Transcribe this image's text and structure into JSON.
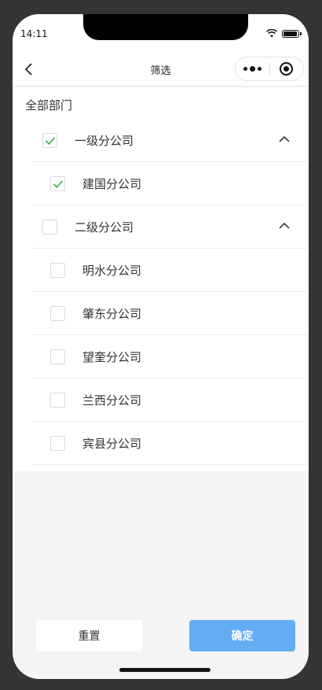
{
  "status": {
    "time": "14:11"
  },
  "nav": {
    "title": "筛选"
  },
  "filter": {
    "section_title": "全部部门",
    "groups": [
      {
        "label": "一级分公司",
        "checked": true,
        "expanded": true,
        "children": [
          {
            "label": "建国分公司",
            "checked": true
          }
        ]
      },
      {
        "label": "二级分公司",
        "checked": false,
        "expanded": true,
        "children": [
          {
            "label": "明水分公司",
            "checked": false
          },
          {
            "label": "肇东分公司",
            "checked": false
          },
          {
            "label": "望奎分公司",
            "checked": false
          },
          {
            "label": "兰西分公司",
            "checked": false
          },
          {
            "label": "宾县分公司",
            "checked": false
          }
        ]
      }
    ]
  },
  "footer": {
    "reset_label": "重置",
    "confirm_label": "确定"
  },
  "colors": {
    "accent": "#64adf5",
    "check": "#2bb24c"
  }
}
